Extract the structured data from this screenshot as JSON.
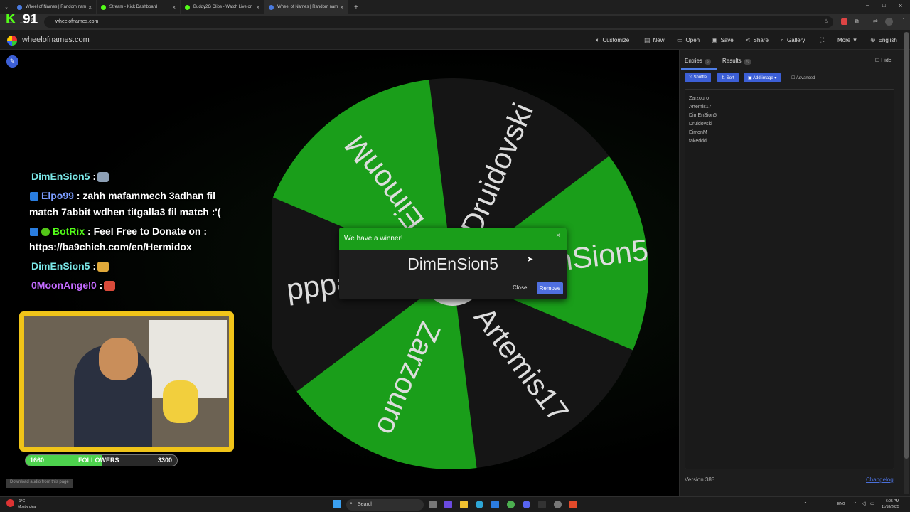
{
  "browser": {
    "tabs": [
      {
        "label": "Wheel of Names | Random nam",
        "color": "#4a7be0",
        "active": false
      },
      {
        "label": "Stream - Kick Dashboard",
        "color": "#53fc18",
        "active": false
      },
      {
        "label": "Buddy2G Clips - Watch Live on",
        "color": "#53fc18",
        "active": false
      },
      {
        "label": "Wheel of Names | Random nam",
        "color": "#4a7be0",
        "active": true
      }
    ],
    "new_tab": "+",
    "url": "wheelofnames.com"
  },
  "site": {
    "name": "wheelofnames.com",
    "menu": [
      {
        "label": "Customize",
        "icon": "palette-icon"
      },
      {
        "label": "New",
        "icon": "file-icon"
      },
      {
        "label": "Open",
        "icon": "folder-icon"
      },
      {
        "label": "Save",
        "icon": "save-icon"
      },
      {
        "label": "Share",
        "icon": "share-icon"
      },
      {
        "label": "Gallery",
        "icon": "search-icon"
      },
      {
        "label": "",
        "icon": "fullscreen-icon"
      },
      {
        "label": "More",
        "icon": "chevron-down-icon"
      },
      {
        "label": "English",
        "icon": "globe-icon"
      }
    ]
  },
  "wheel": {
    "segments": [
      {
        "label": "Druidovski",
        "color": "#151515"
      },
      {
        "label": "DimEnSion5",
        "color": "#1a9e1a"
      },
      {
        "label": "Artemis17",
        "color": "#151515"
      },
      {
        "label": "Zarzouro",
        "color": "#1a9e1a"
      },
      {
        "label": "fakeddd",
        "color": "#151515"
      },
      {
        "label": "EimonM",
        "color": "#1a9e1a"
      }
    ],
    "pointer_color": "#1a9e1a"
  },
  "modal": {
    "title": "We have a winner!",
    "winner": "DimEnSion5",
    "close_label": "Close",
    "remove_label": "Remove",
    "close_icon": "×"
  },
  "sidebar": {
    "tabs": [
      {
        "label": "Entries",
        "count": "6"
      },
      {
        "label": "Results",
        "count": "70"
      }
    ],
    "hide_label": "Hide",
    "toolbar": {
      "shuffle": "Shuffle",
      "sort": "Sort",
      "add_image": "Add image",
      "advanced": "Advanced"
    },
    "entries": [
      "Zarzouro",
      "Artemis17",
      "DimEnSion5",
      "Druidovski",
      "EimonM",
      "fakeddd"
    ],
    "version": "Version 385",
    "changelog": "Changelog"
  },
  "overlay": {
    "viewers": "91",
    "chat": [
      {
        "user": "DimEnSion5",
        "user_color": "#7be8e8",
        "text": " :",
        "badge": false
      },
      {
        "user": "Elpo99",
        "user_color": "#7b9cff",
        "text": " : zahh mafammech 3adhan fil",
        "badge": true
      },
      {
        "user": "",
        "user_color": "#ffffff",
        "text": "match 7abbit wdhen titgalla3 fil match :'(",
        "badge": false
      },
      {
        "user": "BotRix",
        "user_color": "#53fc18",
        "text": " : Feel Free to Donate on :",
        "badge": true
      },
      {
        "user": "",
        "user_color": "#ffffff",
        "text": "https://ba9chich.com/en/Hermidox",
        "badge": false
      },
      {
        "user": "DimEnSion5",
        "user_color": "#7be8e8",
        "text": " :",
        "badge": false
      },
      {
        "user": "0MoonAngel0",
        "user_color": "#c36bff",
        "text": " :",
        "badge": false
      }
    ],
    "followers": {
      "current": "1660",
      "label": "FOLLOWERS",
      "goal": "3300",
      "fraction": 0.503
    },
    "download_text": "Download audio from this page"
  },
  "taskbar": {
    "weather_temp": "-1°C",
    "weather_text": "Mostly clear",
    "search": "Search",
    "lang": "ENG",
    "time": "6:05 PM",
    "date": "11/18/2025"
  }
}
